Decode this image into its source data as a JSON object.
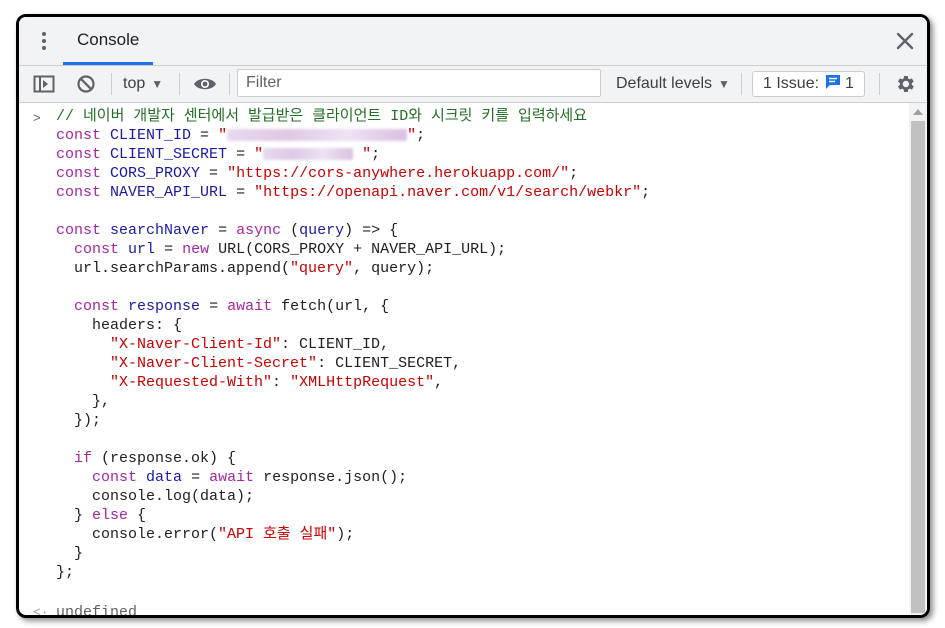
{
  "tabbar": {
    "tab_label": "Console",
    "menu_icon": "kebab-icon",
    "close_icon": "close-icon"
  },
  "toolbar": {
    "sidebar_icon": "sidebar-toggle-icon",
    "clear_icon": "clear-console-icon",
    "context": "top",
    "eye_icon": "eye-icon",
    "filter_placeholder": "Filter",
    "levels": "Default levels",
    "issues_label": "1 Issue:",
    "issues_count": "1",
    "settings_icon": "gear-icon"
  },
  "console": {
    "prompt_glyph": ">",
    "lines": [
      "// 네이버 개발자 센터에서 발급받은 클라이언트 ID와 시크릿 키를 입력하세요",
      "const CLIENT_ID = \"\";",
      "const CLIENT_SECRET = \" \";",
      "const CORS_PROXY = \"https://cors-anywhere.herokuapp.com/\";",
      "const NAVER_API_URL = \"https://openapi.naver.com/v1/search/webkr\";",
      "",
      "const searchNaver = async (query) => {",
      "  const url = new URL(CORS_PROXY + NAVER_API_URL);",
      "  url.searchParams.append(\"query\", query);",
      "",
      "  const response = await fetch(url, {",
      "    headers: {",
      "      \"X-Naver-Client-Id\": CLIENT_ID,",
      "      \"X-Naver-Client-Secret\": CLIENT_SECRET,",
      "      \"X-Requested-With\": \"XMLHttpRequest\",",
      "    },",
      "  });",
      "",
      "  if (response.ok) {",
      "    const data = await response.json();",
      "    console.log(data);",
      "  } else {",
      "    console.error(\"API 호출 실패\");",
      "  }",
      "};"
    ],
    "result_glyph": "<·",
    "result_value": "undefined"
  },
  "colors": {
    "keyword": "#a626a4",
    "identifier": "#1a1aa6",
    "string": "#c80000",
    "comment": "#236e25",
    "accent": "#1a73e8"
  }
}
